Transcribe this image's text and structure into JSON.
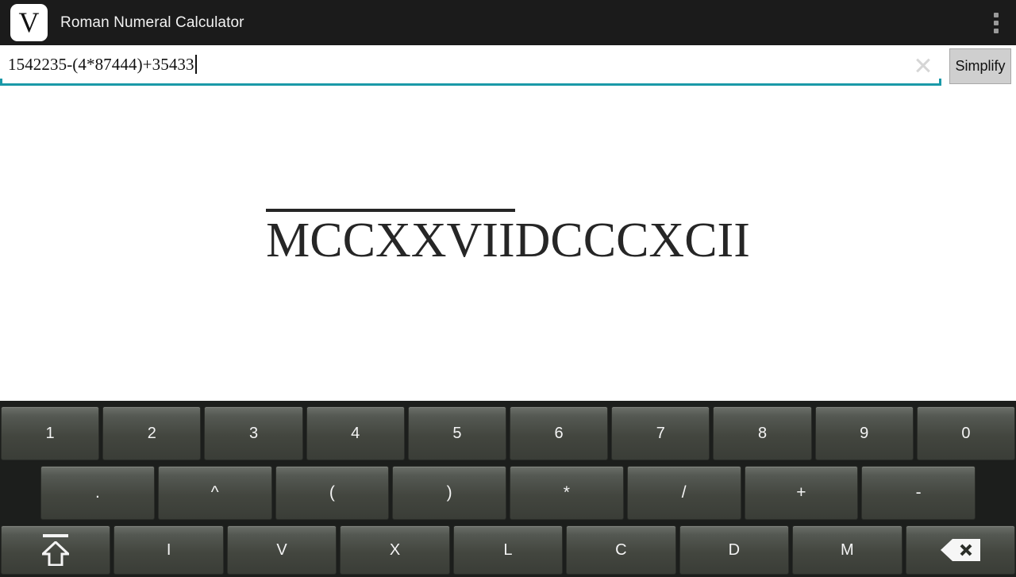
{
  "titlebar": {
    "app_icon_letter": "V",
    "title": "Roman Numeral Calculator",
    "overflow_menu_name": "more-options"
  },
  "input": {
    "value": "1542235-(4*87444)+35433",
    "placeholder": "",
    "clear_icon": "close-icon",
    "underline_color": "#1a99a8"
  },
  "toolbar": {
    "simplify_label": "Simplify"
  },
  "result": {
    "overlined_part": "MCCXXVII",
    "plain_part": "DCCCXCII",
    "full_text": "MCCXXVIIDCCCXCII"
  },
  "keyboard": {
    "row1": [
      {
        "label": "1",
        "name": "key-1"
      },
      {
        "label": "2",
        "name": "key-2"
      },
      {
        "label": "3",
        "name": "key-3"
      },
      {
        "label": "4",
        "name": "key-4"
      },
      {
        "label": "5",
        "name": "key-5"
      },
      {
        "label": "6",
        "name": "key-6"
      },
      {
        "label": "7",
        "name": "key-7"
      },
      {
        "label": "8",
        "name": "key-8"
      },
      {
        "label": "9",
        "name": "key-9"
      },
      {
        "label": "0",
        "name": "key-0"
      }
    ],
    "row2": [
      {
        "label": ".",
        "name": "key-decimal-point"
      },
      {
        "label": "^",
        "name": "key-exponent"
      },
      {
        "label": "(",
        "name": "key-left-paren"
      },
      {
        "label": ")",
        "name": "key-right-paren"
      },
      {
        "label": "*",
        "name": "key-multiply"
      },
      {
        "label": "/",
        "name": "key-divide"
      },
      {
        "label": "+",
        "name": "key-plus"
      },
      {
        "label": "-",
        "name": "key-minus"
      }
    ],
    "row3": [
      {
        "label": "",
        "name": "key-shift-vinculum",
        "icon": "shift-overline-icon"
      },
      {
        "label": "I",
        "name": "key-roman-i"
      },
      {
        "label": "V",
        "name": "key-roman-v"
      },
      {
        "label": "X",
        "name": "key-roman-x"
      },
      {
        "label": "L",
        "name": "key-roman-l"
      },
      {
        "label": "C",
        "name": "key-roman-c"
      },
      {
        "label": "D",
        "name": "key-roman-d"
      },
      {
        "label": "M",
        "name": "key-roman-m"
      },
      {
        "label": "",
        "name": "key-backspace",
        "icon": "backspace-icon"
      }
    ]
  }
}
